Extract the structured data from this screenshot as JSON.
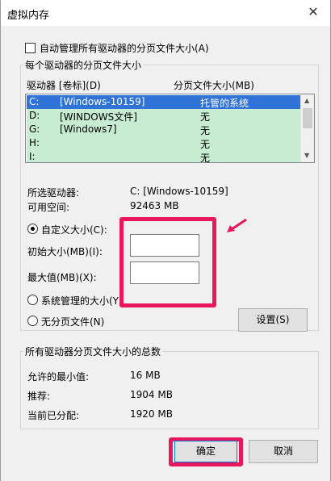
{
  "title": "虚拟内存",
  "auto_manage_label": "自动管理所有驱动器的分页文件大小(A)",
  "per_drive_group_title": "每个驱动器的分页文件大小",
  "columns": {
    "drive": "驱动器 [卷标](D)",
    "size": "分页文件大小(MB)"
  },
  "drives": [
    {
      "letter": "C:",
      "label": "[Windows-10159]",
      "size": "托管的系统",
      "selected": true
    },
    {
      "letter": "D:",
      "label": "[WINDOWS文件]",
      "size": "无"
    },
    {
      "letter": "G:",
      "label": "[Windows7]",
      "size": "无"
    },
    {
      "letter": "H:",
      "label": "",
      "size": "无"
    },
    {
      "letter": "I:",
      "label": "",
      "size": "无"
    }
  ],
  "selected_drive": {
    "label": "所选驱动器:",
    "value": "C:  [Windows-10159]"
  },
  "available_space": {
    "label": "可用空间:",
    "value": "92463 MB"
  },
  "custom_size_label": "自定义大小(C):",
  "initial_size_label": "初始大小(MB)(I):",
  "initial_size_value": "",
  "max_size_label": "最大值(MB)(X):",
  "max_size_value": "",
  "system_managed_label": "系统管理的大小(Y)",
  "no_paging_label": "无分页文件(N)",
  "set_button": "设置(S)",
  "total_group_title": "所有驱动器分页文件大小的总数",
  "totals": [
    {
      "label": "允许的最小值:",
      "value": "16 MB"
    },
    {
      "label": "推荐:",
      "value": "1904 MB"
    },
    {
      "label": "当前已分配:",
      "value": "1920 MB"
    }
  ],
  "ok_button": "确定",
  "cancel_button": "取消",
  "close_icon": "close-icon",
  "highlight_color": "#e8175d"
}
